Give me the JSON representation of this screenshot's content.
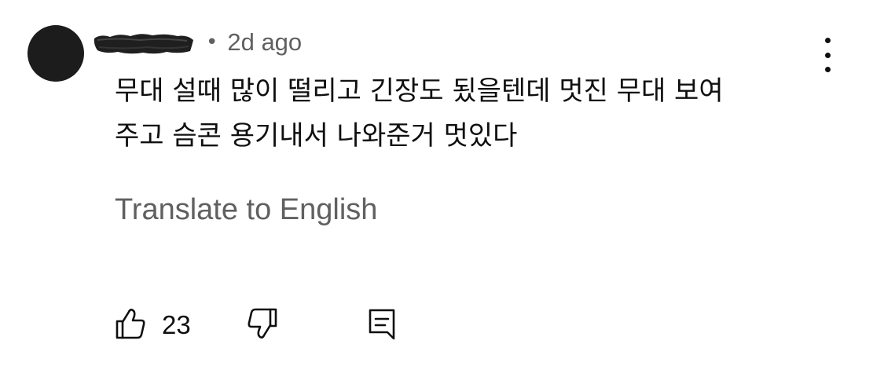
{
  "comment": {
    "time": "2d ago",
    "separator": "•",
    "text_line1": "무대 설때 많이 떨리고 긴장도 됬을텐데 멋진 무대 보여",
    "text_line2": "주고 슴콘 용기내서 나와준거 멋있다",
    "translate_label": "Translate to English",
    "like_count": "23"
  },
  "icons": {
    "avatar": "avatar",
    "author": "redacted-author-name",
    "more": "more-vertical-icon",
    "like": "thumbs-up-icon",
    "dislike": "thumbs-down-icon",
    "reply": "reply-comment-icon"
  },
  "colors": {
    "text_primary": "#0f0f0f",
    "text_secondary": "#606060",
    "avatar": "#1c1c1c"
  }
}
